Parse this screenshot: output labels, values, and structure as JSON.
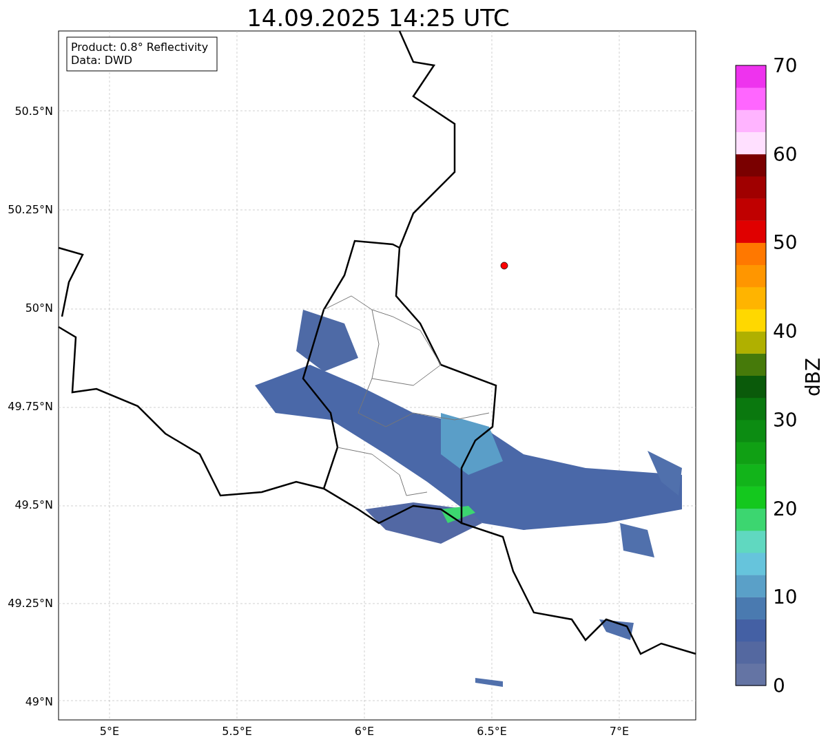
{
  "title": "14.09.2025 14:25 UTC",
  "info_box": [
    "Product: 0.8° Reflectivity",
    "Data: DWD"
  ],
  "x_ticks": [
    "5°E",
    "5.5°E",
    "6°E",
    "6.5°E",
    "7°E"
  ],
  "y_ticks": [
    "50.5°N",
    "50.25°N",
    "50°N",
    "49.75°N",
    "49.5°N",
    "49.25°N",
    "49°N"
  ],
  "colorbar": {
    "label": "dBZ",
    "ticks": [
      "70",
      "60",
      "50",
      "40",
      "30",
      "20",
      "10",
      "0"
    ],
    "bands": [
      {
        "color": "#6474a4"
      },
      {
        "color": "#5468a0"
      },
      {
        "color": "#4460a4"
      },
      {
        "color": "#4a7ab0"
      },
      {
        "color": "#5aa0c8"
      },
      {
        "color": "#66c4dc"
      },
      {
        "color": "#60d8c0"
      },
      {
        "color": "#3cd670"
      },
      {
        "color": "#14c81e"
      },
      {
        "color": "#12b41a"
      },
      {
        "color": "#10a014"
      },
      {
        "color": "#0c8c12"
      },
      {
        "color": "#0a780e"
      },
      {
        "color": "#0a5a0a"
      },
      {
        "color": "#467a0a"
      },
      {
        "color": "#b0b000"
      },
      {
        "color": "#ffd800"
      },
      {
        "color": "#ffb400"
      },
      {
        "color": "#ff9600"
      },
      {
        "color": "#ff7800"
      },
      {
        "color": "#e00000"
      },
      {
        "color": "#c00000"
      },
      {
        "color": "#a00000"
      },
      {
        "color": "#7a0000"
      },
      {
        "color": "#ffe0ff"
      },
      {
        "color": "#ffb4ff"
      },
      {
        "color": "#ff66ff"
      },
      {
        "color": "#ee33ee"
      }
    ]
  }
}
